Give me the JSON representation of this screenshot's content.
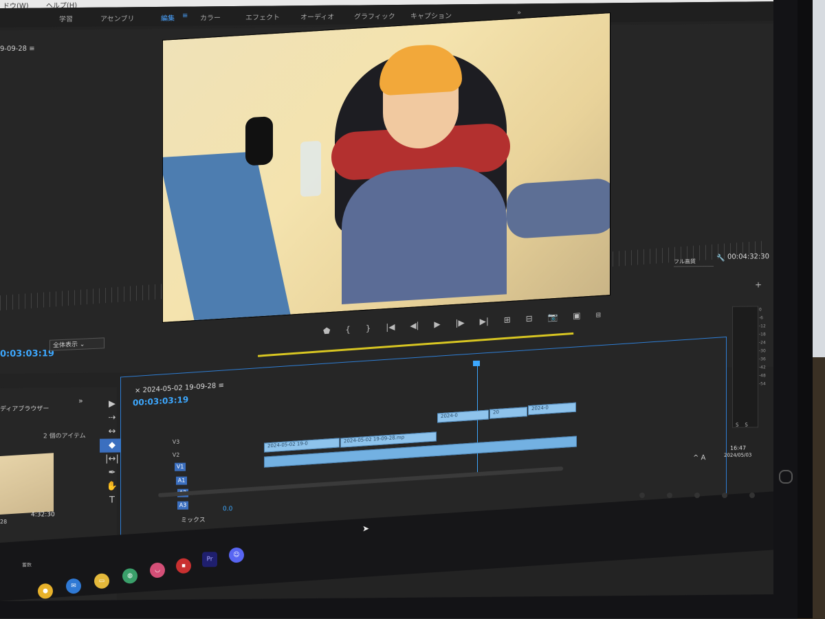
{
  "menu": {
    "window": "ドウ(W)",
    "help": "ヘルプ(H)"
  },
  "workspaces": [
    "学習",
    "アセンブリ",
    "編集",
    "カラー",
    "エフェクト",
    "オーディオ",
    "グラフィック",
    "キャプション"
  ],
  "workspace_active": "編集",
  "workspace_more": "»",
  "program": {
    "sequence_name": "9-09-28",
    "zoom": "フル画質",
    "duration": "00:04:32:30",
    "current_tc": "0:03:03:19",
    "fit": "全体表示",
    "controls": [
      "⬟",
      "{",
      "}",
      "|◀",
      "◀|",
      "▶",
      "|▶",
      "▶|",
      "⊞",
      "⊟",
      "📷",
      "▣",
      "⧈"
    ],
    "plus": "+"
  },
  "project": {
    "title": "ディアブラウザー",
    "more": "»",
    "count": "2 個のアイテム",
    "thumb_duration": "4:32:30",
    "thumb_name": "28"
  },
  "tools": [
    "▶",
    "⇢",
    "↔",
    "◆",
    "|↔|",
    "✒",
    "✋",
    "T"
  ],
  "timeline": {
    "close": "×",
    "name": "2024-05-02 19-09-28",
    "timecode": "00:03:03:19",
    "tracks": [
      "V3",
      "V2",
      "V1",
      "A1",
      "A2",
      "A3"
    ],
    "mix_label": "ミックス",
    "mix_value": "0.0",
    "clips": [
      "2024-05-02 19-0",
      "2024-05-02 19-09-28.mp",
      "2024-0",
      "20",
      "2024-0"
    ],
    "vu_scale": [
      "0",
      "-6",
      "-12",
      "-18",
      "-24",
      "-30",
      "-36",
      "-42",
      "-48",
      "-54"
    ],
    "solo": [
      "S",
      "S"
    ]
  },
  "taskbar": {
    "time": "16:47",
    "date": "2024/05/03",
    "tray": "^ A",
    "icons": [
      "chrome-icon",
      "mail-icon",
      "folder-icon",
      "globe-icon",
      "lips-icon",
      "record-icon",
      "premiere-icon",
      "discord-icon"
    ],
    "premiere_label": "Pr",
    "left_label": "蓄数"
  },
  "colors": {
    "accent": "#3da8ff",
    "clip": "#8ec3ec",
    "yellow": "#d8c622"
  }
}
